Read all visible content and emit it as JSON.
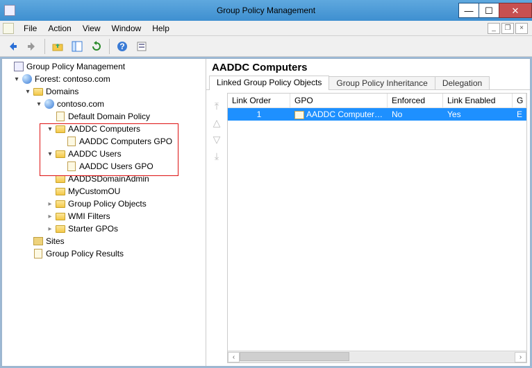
{
  "window": {
    "title": "Group Policy Management"
  },
  "menu": {
    "file": "File",
    "action": "Action",
    "view": "View",
    "window": "Window",
    "help": "Help"
  },
  "tree": {
    "root": "Group Policy Management",
    "forest": "Forest: contoso.com",
    "domains": "Domains",
    "domain": "contoso.com",
    "default_policy": "Default Domain Policy",
    "aaddc_computers": "AADDC Computers",
    "aaddc_computers_gpo": "AADDC Computers GPO",
    "aaddc_users": "AADDC Users",
    "aaddc_users_gpo": "AADDC Users GPO",
    "aadds_domain_admin": "AADDSDomainAdmin",
    "my_custom_ou": "MyCustomOU",
    "gp_objects": "Group Policy Objects",
    "wmi_filters": "WMI Filters",
    "starter_gpos": "Starter GPOs",
    "sites": "Sites",
    "gp_results": "Group Policy Results"
  },
  "detail": {
    "heading": "AADDC Computers",
    "tabs": {
      "linked": "Linked Group Policy Objects",
      "inheritance": "Group Policy Inheritance",
      "delegation": "Delegation"
    },
    "columns": {
      "link_order": "Link Order",
      "gpo": "GPO",
      "enforced": "Enforced",
      "link_enabled": "Link Enabled",
      "g": "G"
    },
    "row": {
      "order": "1",
      "gpo": "AADDC Computers ...",
      "enforced": "No",
      "enabled": "Yes",
      "g": "E"
    }
  }
}
